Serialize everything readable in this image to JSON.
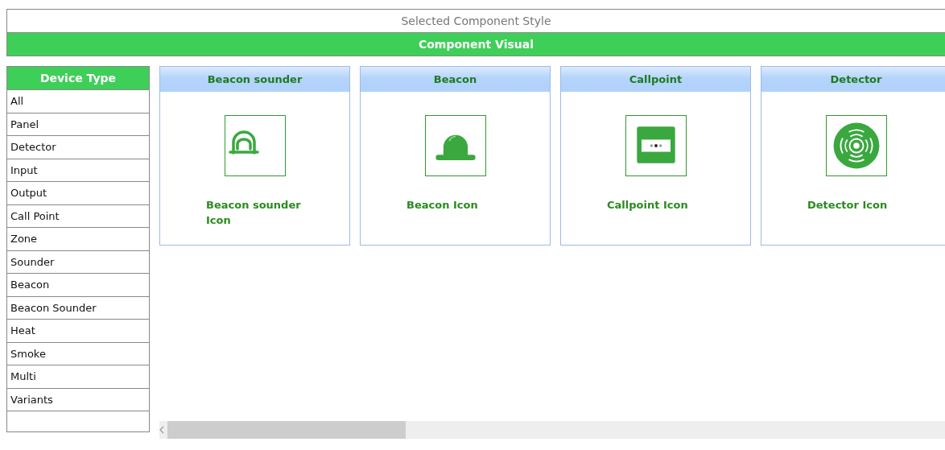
{
  "header": {
    "title": "Selected Component Style",
    "subtitle": "Component Visual"
  },
  "device_types": {
    "heading": "Device Type",
    "items": [
      {
        "label": "All",
        "selected": false
      },
      {
        "label": "Panel",
        "selected": false
      },
      {
        "label": "Detector",
        "selected": false
      },
      {
        "label": "Input",
        "selected": false
      },
      {
        "label": "Output",
        "selected": false
      },
      {
        "label": "Call Point",
        "selected": false
      },
      {
        "label": "Zone",
        "selected": false
      },
      {
        "label": "Sounder",
        "selected": false
      },
      {
        "label": "Beacon",
        "selected": false
      },
      {
        "label": "Beacon Sounder",
        "selected": false
      },
      {
        "label": "Heat",
        "selected": false
      },
      {
        "label": "Smoke",
        "selected": false
      },
      {
        "label": "Multi",
        "selected": false
      },
      {
        "label": "Variants",
        "selected": false
      }
    ]
  },
  "cards": [
    {
      "title": "Beacon sounder",
      "kind": "beacon-sounder",
      "caption": "Beacon sounder Icon"
    },
    {
      "title": "Beacon",
      "kind": "beacon",
      "caption": "Beacon Icon"
    },
    {
      "title": "Callpoint",
      "kind": "callpoint",
      "caption": "Callpoint Icon"
    },
    {
      "title": "Detector",
      "kind": "detector",
      "caption": "Detector Icon"
    }
  ]
}
